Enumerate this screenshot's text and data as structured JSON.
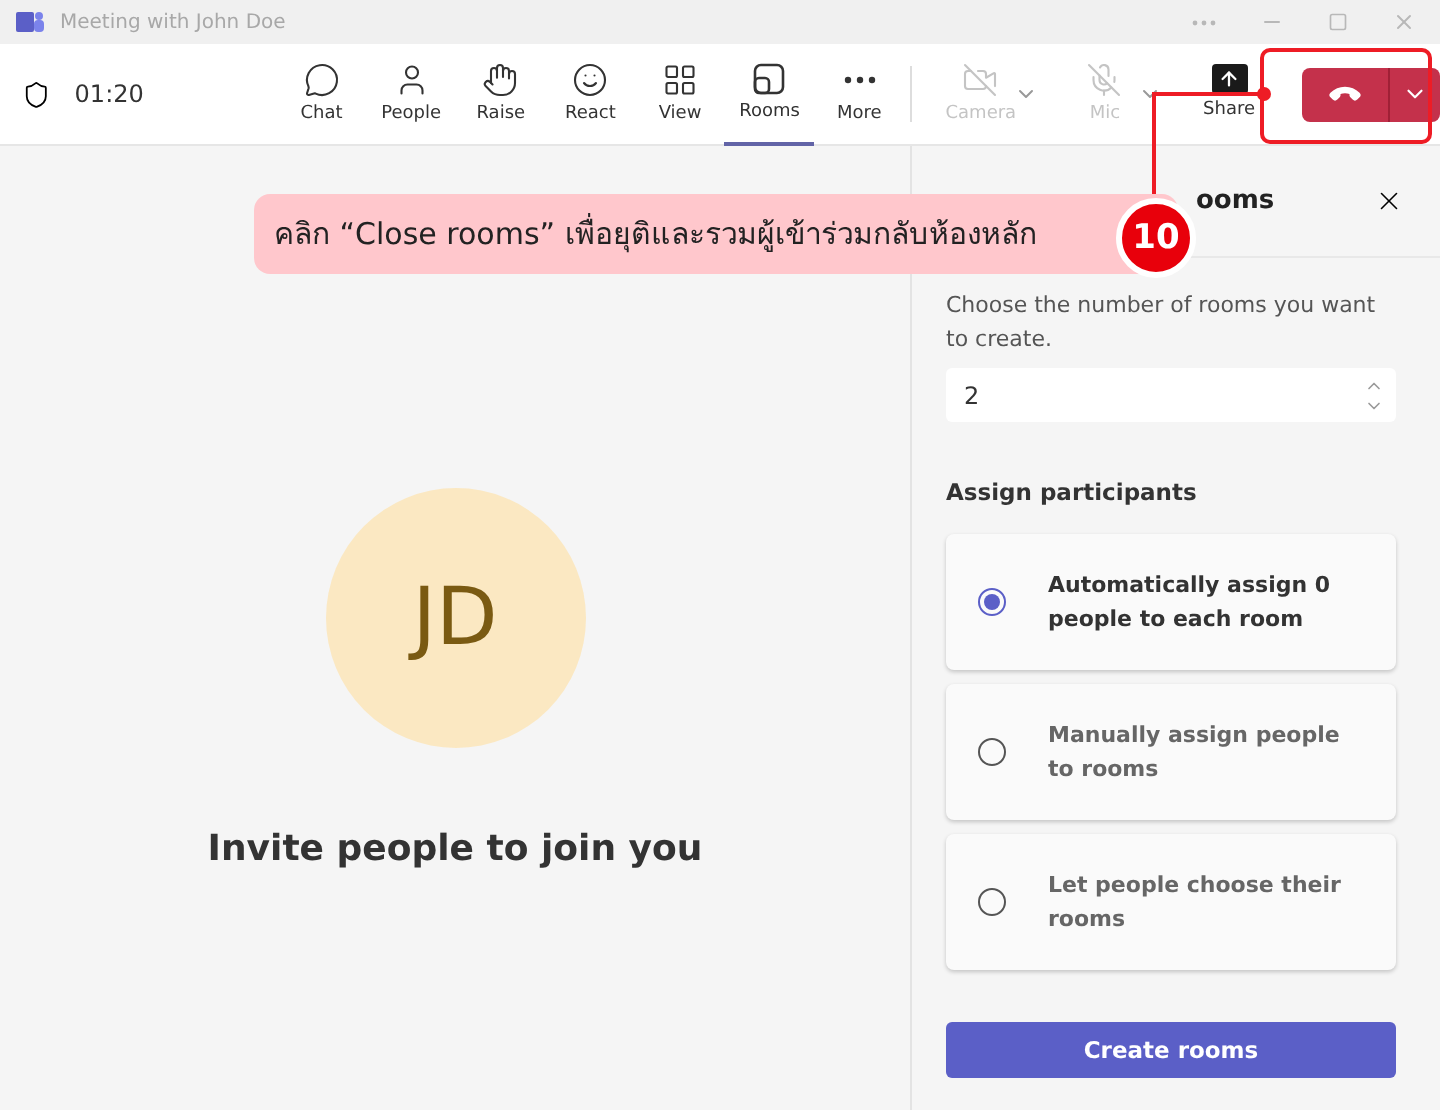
{
  "window": {
    "title": "Meeting with John Doe"
  },
  "toolbar": {
    "timer": "01:20",
    "items": [
      {
        "label": "Chat",
        "selected": false,
        "disabled": false,
        "has_menu": false
      },
      {
        "label": "People",
        "selected": false,
        "disabled": false,
        "has_menu": false
      },
      {
        "label": "Raise",
        "selected": false,
        "disabled": false,
        "has_menu": false
      },
      {
        "label": "React",
        "selected": false,
        "disabled": false,
        "has_menu": false
      },
      {
        "label": "View",
        "selected": false,
        "disabled": false,
        "has_menu": false
      },
      {
        "label": "Rooms",
        "selected": true,
        "disabled": false,
        "has_menu": false
      },
      {
        "label": "More",
        "selected": false,
        "disabled": false,
        "has_menu": false
      },
      {
        "label": "Camera",
        "selected": false,
        "disabled": true,
        "has_menu": true
      },
      {
        "label": "Mic",
        "selected": false,
        "disabled": true,
        "has_menu": true
      },
      {
        "label": "Share",
        "selected": false,
        "disabled": false,
        "has_menu": false
      }
    ]
  },
  "stage": {
    "initials": "JD",
    "message": "Invite people to join you"
  },
  "panel": {
    "title": "ooms",
    "prompt": "Choose the number of rooms you want to create.",
    "room_count": "2",
    "section": "Assign participants",
    "options": [
      {
        "label": "Automatically assign 0 people to each room",
        "selected": true
      },
      {
        "label": "Manually assign people to rooms",
        "selected": false
      },
      {
        "label": "Let people choose their rooms",
        "selected": false
      }
    ],
    "button": "Create rooms"
  },
  "annotation": {
    "text": "คลิก “Close rooms” เพื่อยุติและรวมผู้เข้าร่วมกลับห้องหลัก",
    "step": "10"
  }
}
